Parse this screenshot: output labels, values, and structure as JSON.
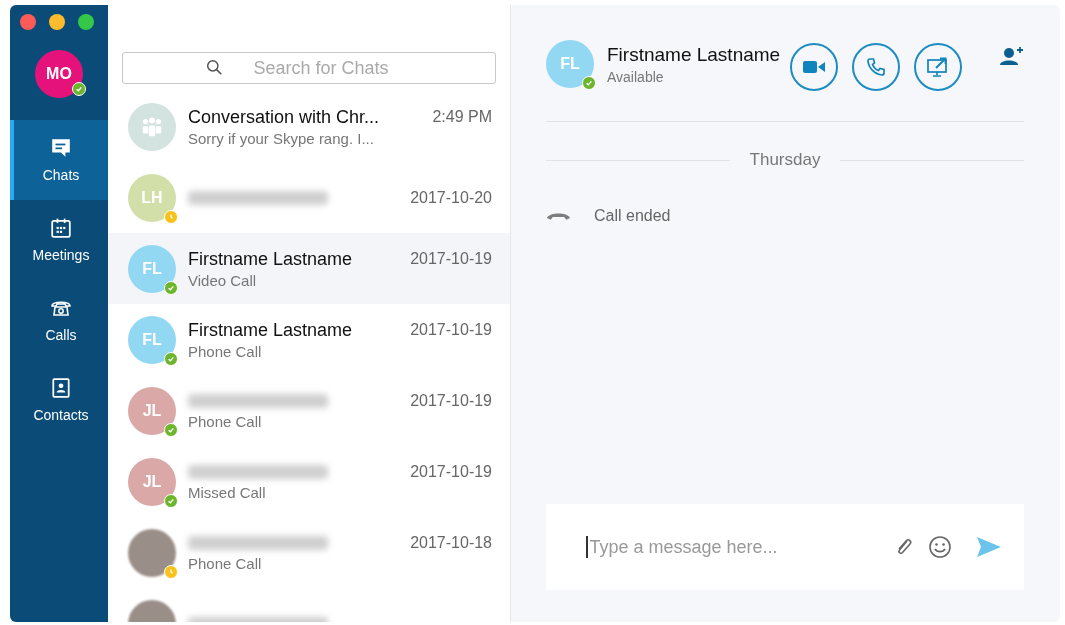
{
  "window": {
    "controls": [
      {
        "kind": "close"
      },
      {
        "kind": "minimize"
      },
      {
        "kind": "zoom"
      }
    ]
  },
  "profile": {
    "initials": "MO",
    "badge": {
      "kind": "available"
    }
  },
  "nav": [
    {
      "kind": "chat",
      "label": "Chats",
      "selected": true
    },
    {
      "kind": "calendar",
      "label": "Meetings",
      "selected": false
    },
    {
      "kind": "phone",
      "label": "Calls",
      "selected": false
    },
    {
      "kind": "contacts",
      "label": "Contacts",
      "selected": false
    }
  ],
  "search": {
    "placeholder": "Search for Chats"
  },
  "chats": [
    {
      "kind": "group",
      "color": "#d3e3e0",
      "name": "Conversation with Chr...",
      "preview": "Sorry if your Skype rang. I...",
      "time": "2:49 PM",
      "selected": false
    },
    {
      "kind": "initials",
      "initials": "LH",
      "color": "#d2dfa8",
      "badge": {
        "kind": "away"
      },
      "blurred": true,
      "time": "2017-10-20",
      "selected": false
    },
    {
      "kind": "initials",
      "initials": "FL",
      "color": "#93d8f3",
      "badge": {
        "kind": "available"
      },
      "name": "Firstname Lastname",
      "preview": "Video Call",
      "time": "2017-10-19",
      "selected": true
    },
    {
      "kind": "initials",
      "initials": "FL",
      "color": "#93d8f3",
      "badge": {
        "kind": "available"
      },
      "name": "Firstname Lastname",
      "preview": "Phone Call",
      "time": "2017-10-19",
      "selected": false
    },
    {
      "kind": "initials",
      "initials": "JL",
      "color": "#d9a8a7",
      "badge": {
        "kind": "available"
      },
      "blurred": true,
      "preview": "Phone Call",
      "time": "2017-10-19",
      "selected": false
    },
    {
      "kind": "initials",
      "initials": "JL",
      "color": "#d9a8a7",
      "badge": {
        "kind": "available"
      },
      "blurred": true,
      "preview": "Missed Call",
      "time": "2017-10-19",
      "selected": false
    },
    {
      "kind": "photo",
      "color": "#9a8f88",
      "badge": {
        "kind": "away"
      },
      "blurred": true,
      "preview": "Phone Call",
      "time": "2017-10-18",
      "selected": false
    },
    {
      "kind": "photo",
      "color": "#9a8f88",
      "blurred": true,
      "selected": false
    }
  ],
  "conversation": {
    "initials": "FL",
    "color": "#93d8f3",
    "badge": {
      "kind": "available"
    },
    "name": "Firstname Lastname",
    "presence": "Available",
    "actions": [
      {
        "kind": "video"
      },
      {
        "kind": "call"
      },
      {
        "kind": "share"
      }
    ],
    "day": "Thursday",
    "events": [
      {
        "kind": "call_ended",
        "text": "Call ended"
      }
    ],
    "composer": {
      "placeholder": "Type a message here..."
    }
  }
}
